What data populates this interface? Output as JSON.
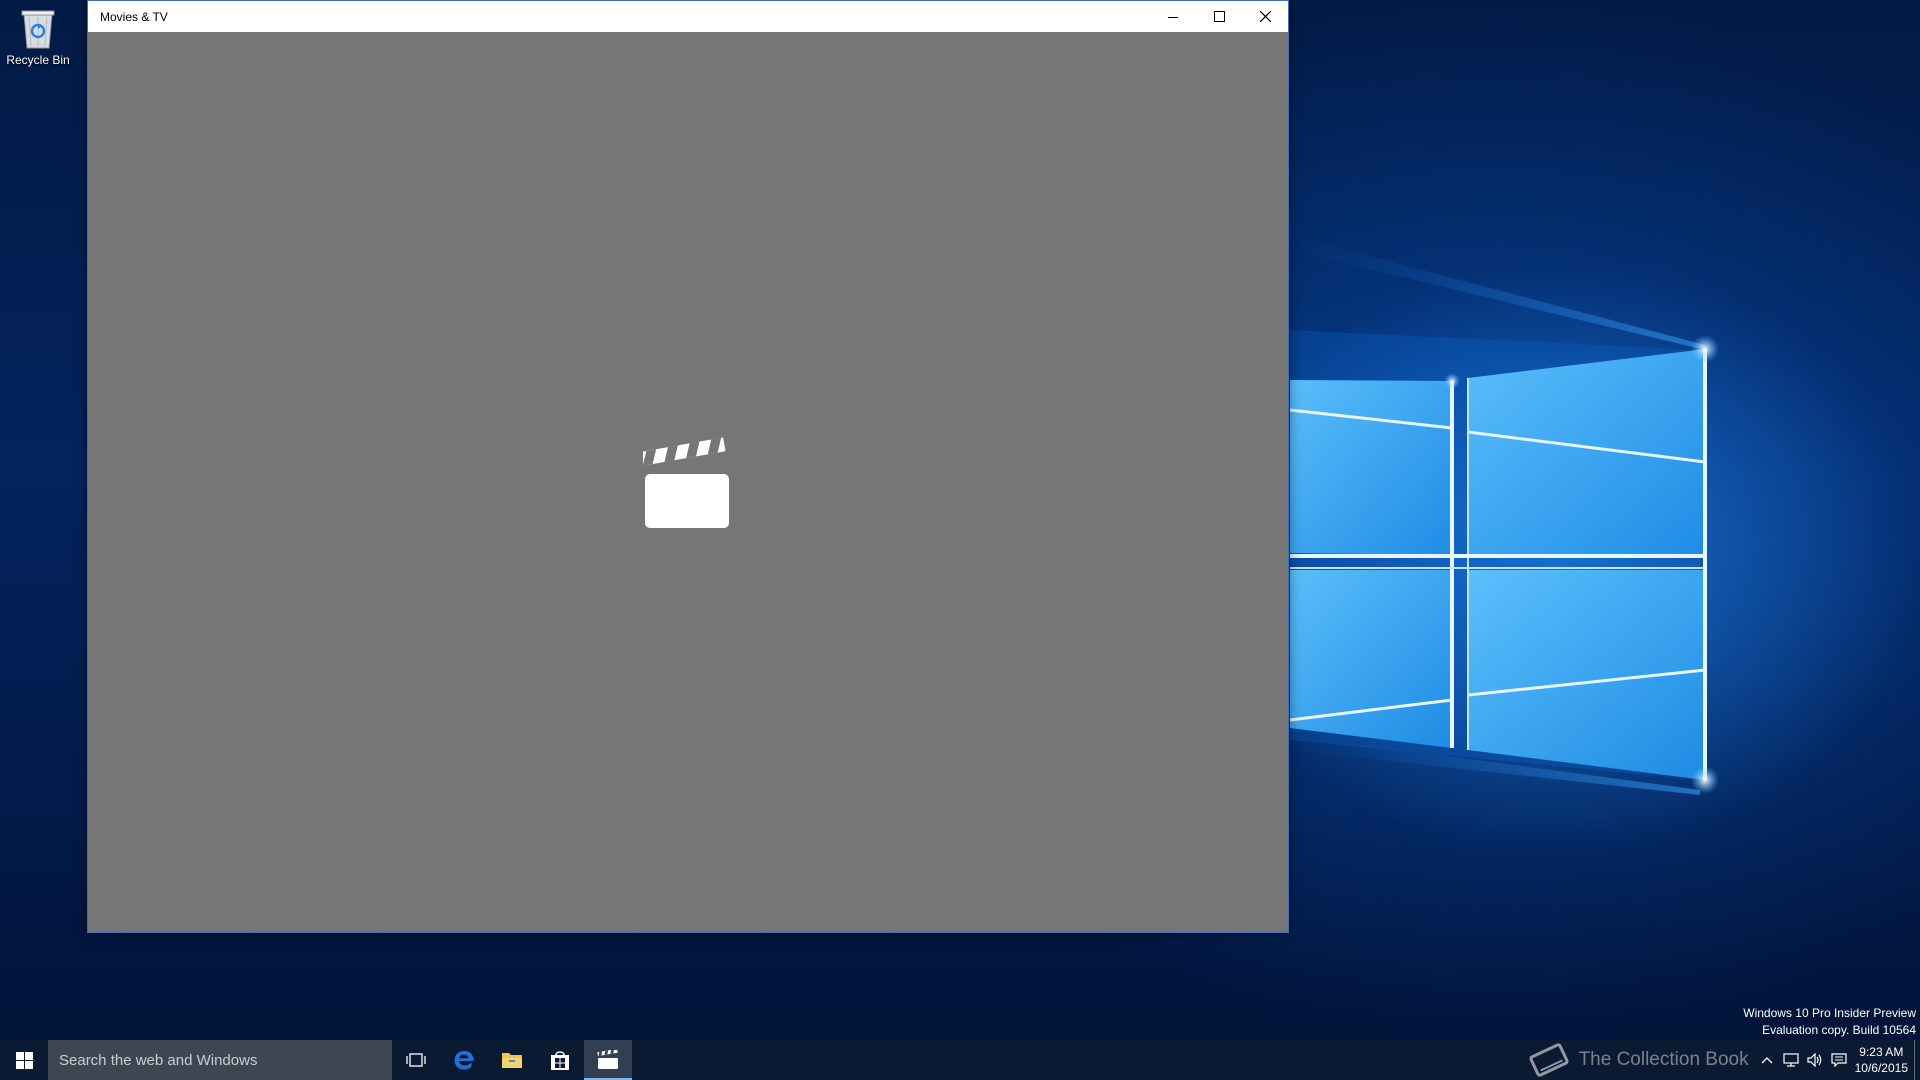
{
  "desktop": {
    "icons": [
      {
        "label": "Recycle Bin",
        "icon": "recycle-bin-icon"
      }
    ],
    "watermark": {
      "line1": "Windows 10 Pro Insider Preview",
      "line2": "Evaluation copy. Build 10564"
    }
  },
  "window": {
    "title": "Movies & TV",
    "buttons": {
      "minimize": "minimize-icon",
      "maximize": "maximize-icon",
      "close": "close-icon"
    },
    "content": {
      "background": "#767676",
      "splash_icon": "clapperboard-icon"
    }
  },
  "taskbar": {
    "search_placeholder": "Search the web and Windows",
    "apps": [
      {
        "name": "Task View",
        "icon": "task-view-icon"
      },
      {
        "name": "Microsoft Edge",
        "icon": "edge-icon"
      },
      {
        "name": "File Explorer",
        "icon": "file-explorer-icon"
      },
      {
        "name": "Store",
        "icon": "store-icon"
      },
      {
        "name": "Movies & TV",
        "icon": "movies-tv-icon",
        "active": true
      }
    ],
    "tray": {
      "watermark_text": "The Collection Book",
      "time": "9:23 AM",
      "date": "10/6/2015"
    }
  },
  "colors": {
    "accent": "#3d6fb4",
    "taskbar": "#0b1a33",
    "search_box": "#3f4652",
    "edge_blue": "#1e73d6",
    "explorer_yellow": "#f2c14e"
  }
}
